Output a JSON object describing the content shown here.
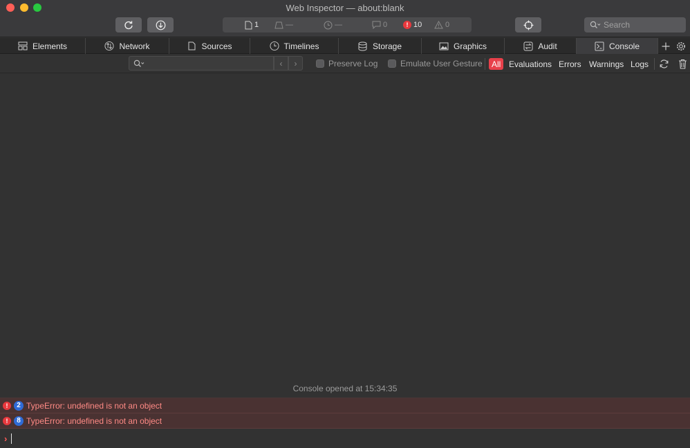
{
  "window": {
    "title": "Web Inspector — about:blank"
  },
  "dashboard": {
    "resources": "1",
    "size": "—",
    "time": "—",
    "logs": "0",
    "errors": "10",
    "warnings": "0"
  },
  "search": {
    "placeholder": "Search"
  },
  "tabs": [
    {
      "label": "Elements",
      "icon": "elements-icon"
    },
    {
      "label": "Network",
      "icon": "network-icon"
    },
    {
      "label": "Sources",
      "icon": "sources-icon"
    },
    {
      "label": "Timelines",
      "icon": "timelines-icon"
    },
    {
      "label": "Storage",
      "icon": "storage-icon"
    },
    {
      "label": "Graphics",
      "icon": "graphics-icon"
    },
    {
      "label": "Audit",
      "icon": "audit-icon"
    },
    {
      "label": "Console",
      "icon": "console-icon",
      "selected": true
    }
  ],
  "filter": {
    "preserve_log": "Preserve Log",
    "emulate_gesture": "Emulate User Gesture",
    "levels": {
      "all": "All",
      "evaluations": "Evaluations",
      "errors": "Errors",
      "warnings": "Warnings",
      "logs": "Logs"
    }
  },
  "console": {
    "session_marker": "Console opened at 15:34:35",
    "messages": [
      {
        "count": "2",
        "text": "TypeError: undefined is not an object"
      },
      {
        "count": "8",
        "text": "TypeError: undefined is not an object"
      }
    ]
  },
  "colors": {
    "accent_red": "#e8404a",
    "error_text": "#ff8a85",
    "badge_blue": "#2f6bd6"
  }
}
